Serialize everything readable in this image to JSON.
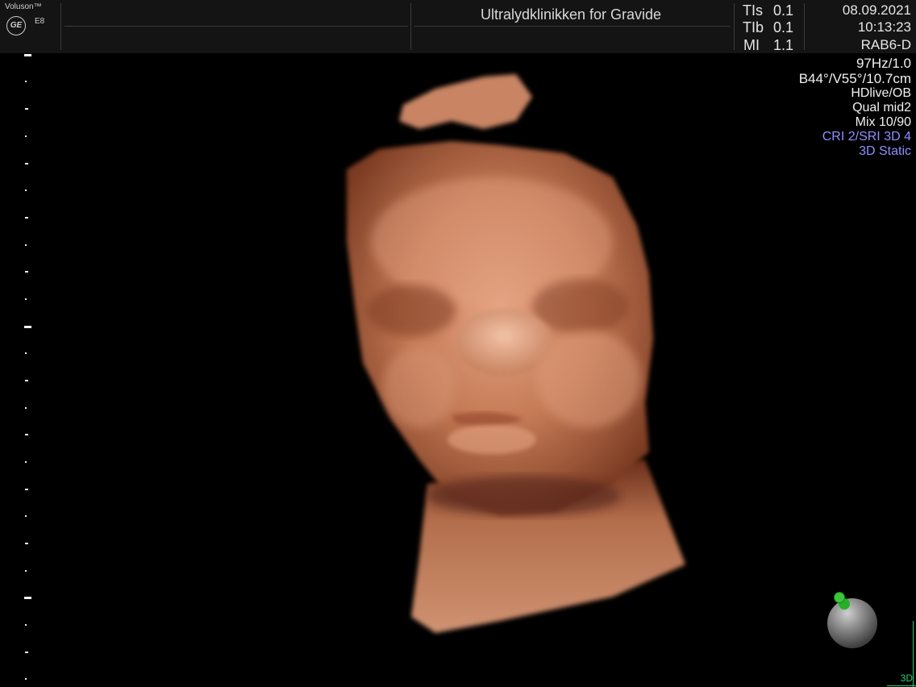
{
  "header": {
    "brand": "Voluson™",
    "model": "E8",
    "logo": "GE",
    "clinic": "Ultralydklinikken for Gravide",
    "params": [
      {
        "label": "TIs",
        "value": "0.1"
      },
      {
        "label": "TIb",
        "value": "0.1"
      },
      {
        "label": "MI",
        "value": "1.1"
      }
    ],
    "date": "08.09.2021",
    "time": "10:13:23",
    "probe": "RAB6-D"
  },
  "info": {
    "freq": "97Hz/1.0",
    "angles": "B44°/V55°/10.7cm",
    "mode": "HDlive/OB",
    "quality": "Qual mid2",
    "mix": "Mix 10/90",
    "cri": "CRI 2/SRI 3D 4",
    "static": "3D Static"
  },
  "view_mode": "3D",
  "colors": {
    "skin": "#c47a55",
    "background": "#000000",
    "accent_text": "#8f8fff",
    "indicator": "#2ecc71"
  }
}
